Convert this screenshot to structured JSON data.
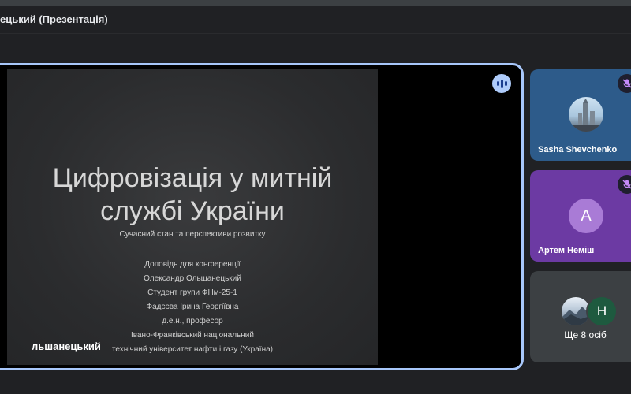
{
  "window": {
    "title": "ецький (Презентація)"
  },
  "presentation": {
    "presenter_label": "льшанецький",
    "slide": {
      "title_line1": "Цифровізація у митній",
      "title_line2": "службі України",
      "subtitle": "Сучасний стан та перспективи розвитку",
      "lines": [
        "Доповідь для конференції",
        "Олександр Ольшанецький",
        "Студент групи ФНм-25-1",
        "Фадєєва Ірина Георгіївна",
        "д.е.н., професор",
        "Івано-Франківський національний",
        "технічний університет нафти і газу (Україна)"
      ]
    }
  },
  "participants": [
    {
      "name": "Sasha Shevchenko",
      "mic": "muted",
      "avatar": "photo"
    },
    {
      "name": "Артем Неміш",
      "mic": "muted",
      "avatar_letter": "A",
      "tile_color": "#6c3aa3"
    }
  ],
  "more_tile": {
    "label": "Ще 8 осіб",
    "avatar_letter": "Н"
  },
  "colors": {
    "active_border": "#a8c7fa",
    "background": "#202124"
  },
  "icons": [
    "speaking-icon",
    "mic-off-icon"
  ]
}
